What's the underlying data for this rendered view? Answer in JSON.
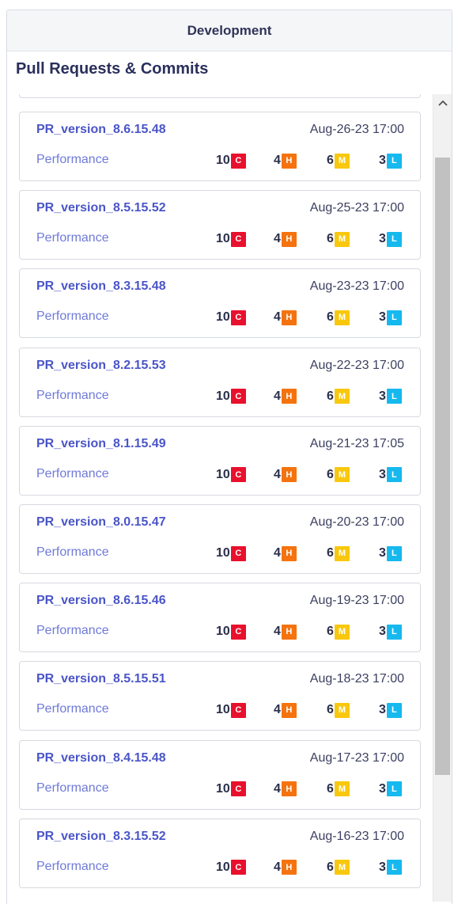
{
  "panel": {
    "tab_label": "Development",
    "section_title": "Pull Requests & Commits"
  },
  "severity_badges": {
    "critical": {
      "letter": "C",
      "color": "#e8112d"
    },
    "high": {
      "letter": "H",
      "color": "#f5730f"
    },
    "medium": {
      "letter": "M",
      "color": "#f9c80e"
    },
    "low": {
      "letter": "L",
      "color": "#16b9ee"
    }
  },
  "colors": {
    "pr_name": "#4a55c8",
    "category": "#6f7ad8",
    "title": "#2a2f5b"
  },
  "pull_requests": [
    {
      "name": "PR_version_8.6.15.48",
      "date": "Aug-26-23 17:00",
      "category": "Performance",
      "critical": "10",
      "high": "4",
      "medium": "6",
      "low": "3"
    },
    {
      "name": "PR_version_8.5.15.52",
      "date": "Aug-25-23 17:00",
      "category": "Performance",
      "critical": "10",
      "high": "4",
      "medium": "6",
      "low": "3"
    },
    {
      "name": "PR_version_8.3.15.48",
      "date": "Aug-23-23 17:00",
      "category": "Performance",
      "critical": "10",
      "high": "4",
      "medium": "6",
      "low": "3"
    },
    {
      "name": "PR_version_8.2.15.53",
      "date": "Aug-22-23 17:00",
      "category": "Performance",
      "critical": "10",
      "high": "4",
      "medium": "6",
      "low": "3"
    },
    {
      "name": "PR_version_8.1.15.49",
      "date": "Aug-21-23 17:05",
      "category": "Performance",
      "critical": "10",
      "high": "4",
      "medium": "6",
      "low": "3"
    },
    {
      "name": "PR_version_8.0.15.47",
      "date": "Aug-20-23 17:00",
      "category": "Performance",
      "critical": "10",
      "high": "4",
      "medium": "6",
      "low": "3"
    },
    {
      "name": "PR_version_8.6.15.46",
      "date": "Aug-19-23 17:00",
      "category": "Performance",
      "critical": "10",
      "high": "4",
      "medium": "6",
      "low": "3"
    },
    {
      "name": "PR_version_8.5.15.51",
      "date": "Aug-18-23 17:00",
      "category": "Performance",
      "critical": "10",
      "high": "4",
      "medium": "6",
      "low": "3"
    },
    {
      "name": "PR_version_8.4.15.48",
      "date": "Aug-17-23 17:00",
      "category": "Performance",
      "critical": "10",
      "high": "4",
      "medium": "6",
      "low": "3"
    },
    {
      "name": "PR_version_8.3.15.52",
      "date": "Aug-16-23 17:00",
      "category": "Performance",
      "critical": "10",
      "high": "4",
      "medium": "6",
      "low": "3"
    }
  ],
  "scrollbar": {
    "up_icon": "chevron-up-icon"
  }
}
